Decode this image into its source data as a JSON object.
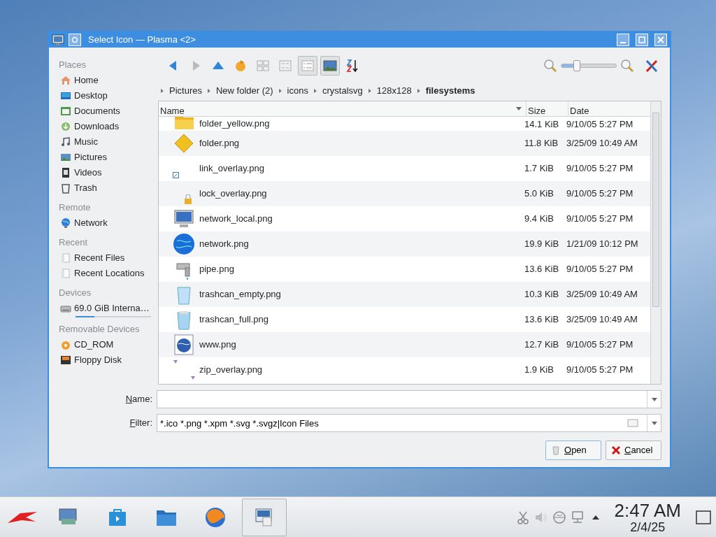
{
  "window": {
    "title": "Select Icon — Plasma <2>"
  },
  "sidebar": {
    "sections": [
      {
        "heading": "Places",
        "items": [
          {
            "label": "Home"
          },
          {
            "label": "Desktop"
          },
          {
            "label": "Documents"
          },
          {
            "label": "Downloads"
          },
          {
            "label": "Music"
          },
          {
            "label": "Pictures"
          },
          {
            "label": "Videos"
          },
          {
            "label": "Trash"
          }
        ]
      },
      {
        "heading": "Remote",
        "items": [
          {
            "label": "Network"
          }
        ]
      },
      {
        "heading": "Recent",
        "items": [
          {
            "label": "Recent Files"
          },
          {
            "label": "Recent Locations"
          }
        ]
      },
      {
        "heading": "Devices",
        "items": [
          {
            "label": "69.0 GiB Interna…",
            "level": 0.25
          }
        ]
      },
      {
        "heading": "Removable Devices",
        "items": [
          {
            "label": "CD_ROM"
          },
          {
            "label": "Floppy Disk"
          }
        ]
      }
    ]
  },
  "toolbar": {
    "view_modes": [
      {
        "selected": false
      },
      {
        "selected": false
      },
      {
        "selected": true
      }
    ],
    "preview": {
      "on": true
    },
    "zoom": {
      "level": 0.28
    }
  },
  "breadcrumb": [
    "Pictures",
    "New folder (2)",
    "icons",
    "crystalsvg",
    "128x128",
    "filesystems"
  ],
  "table": {
    "columns": [
      "Name",
      "Size",
      "Date"
    ],
    "rows": [
      {
        "name": "folder_yellow.png",
        "size": "14.1 KiB",
        "date": "9/10/05 5:27 PM"
      },
      {
        "name": "folder.png",
        "size": "11.8 KiB",
        "date": "3/25/09 10:49 AM"
      },
      {
        "name": "link_overlay.png",
        "size": "1.7 KiB",
        "date": "9/10/05 5:27 PM"
      },
      {
        "name": "lock_overlay.png",
        "size": "5.0 KiB",
        "date": "9/10/05 5:27 PM"
      },
      {
        "name": "network_local.png",
        "size": "9.4 KiB",
        "date": "9/10/05 5:27 PM"
      },
      {
        "name": "network.png",
        "size": "19.9 KiB",
        "date": "1/21/09 10:12 PM"
      },
      {
        "name": "pipe.png",
        "size": "13.6 KiB",
        "date": "9/10/05 5:27 PM"
      },
      {
        "name": "trashcan_empty.png",
        "size": "10.3 KiB",
        "date": "3/25/09 10:49 AM"
      },
      {
        "name": "trashcan_full.png",
        "size": "13.6 KiB",
        "date": "3/25/09 10:49 AM"
      },
      {
        "name": "www.png",
        "size": "12.7 KiB",
        "date": "9/10/05 5:27 PM"
      },
      {
        "name": "zip_overlay.png",
        "size": "1.9 KiB",
        "date": "9/10/05 5:27 PM"
      }
    ]
  },
  "name_field": {
    "label": "Name:"
  },
  "filter_field": {
    "label": "Filter:",
    "value": "*.ico *.png *.xpm *.svg *.svgz|Icon Files"
  },
  "buttons": [
    "Open",
    "Cancel"
  ],
  "taskbar": {
    "tasks": [
      {
        "selected": false
      },
      {
        "selected": false
      },
      {
        "selected": false
      },
      {
        "selected": false
      },
      {
        "selected": true
      }
    ],
    "time": "2:47 AM",
    "date": "2/4/25"
  }
}
